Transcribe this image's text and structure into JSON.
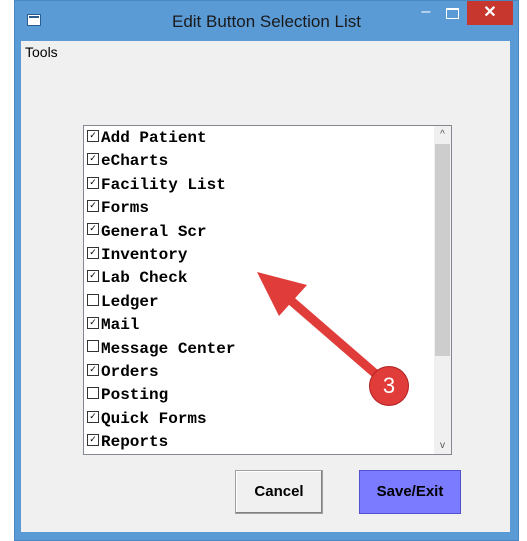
{
  "window": {
    "title": "Edit Button Selection List",
    "minimize_symbol": "–",
    "close_symbol": "✕"
  },
  "menu": {
    "tools": "Tools"
  },
  "list": {
    "items": [
      {
        "label": "Add Patient",
        "checked": true
      },
      {
        "label": "eCharts",
        "checked": true
      },
      {
        "label": "Facility List",
        "checked": true
      },
      {
        "label": "Forms",
        "checked": true
      },
      {
        "label": "General Scr",
        "checked": true
      },
      {
        "label": "Inventory",
        "checked": true
      },
      {
        "label": "Lab Check",
        "checked": true
      },
      {
        "label": "Ledger",
        "checked": false
      },
      {
        "label": "Mail",
        "checked": true
      },
      {
        "label": "Message Center",
        "checked": false
      },
      {
        "label": "Orders",
        "checked": true
      },
      {
        "label": "Posting",
        "checked": false
      },
      {
        "label": "Quick Forms",
        "checked": true
      },
      {
        "label": "Reports",
        "checked": true
      }
    ],
    "scroll_up_symbol": "^",
    "scroll_down_symbol": "v"
  },
  "buttons": {
    "cancel": "Cancel",
    "save_exit": "Save/Exit"
  },
  "annotation": {
    "badge_number": "3",
    "color": "#e03c3a"
  }
}
